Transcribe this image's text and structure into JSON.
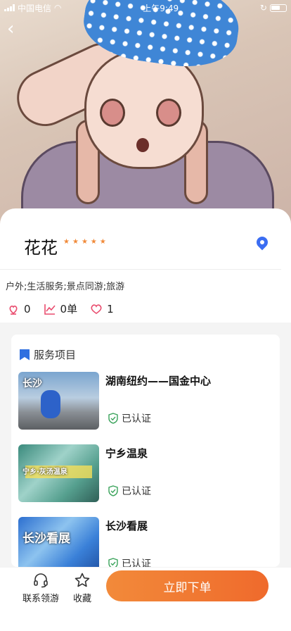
{
  "status_bar": {
    "carrier": "中国电信",
    "time": "上午9:49"
  },
  "provider": {
    "name": "花花",
    "rating_stars": 5,
    "tags": "户外;生活服务;景点同游;旅游",
    "stats": {
      "favorites": "0",
      "orders": "0单",
      "likes": "1"
    }
  },
  "services": {
    "title": "服务项目",
    "items": [
      {
        "title": "湖南纽约——国金中心",
        "thumb_text": "长沙",
        "badge": "已认证"
      },
      {
        "title": "宁乡温泉",
        "thumb_text": "宁乡·灰汤温泉",
        "badge": "已认证"
      },
      {
        "title": "长沙看展",
        "thumb_text": "长沙看展",
        "badge": "已认证"
      }
    ]
  },
  "bottom_bar": {
    "contact_label": "联系领游",
    "favorite_label": "收藏",
    "order_label": "立即下单"
  },
  "colors": {
    "accent": "#ef6a2c",
    "blue": "#2f6fe0",
    "star": "#f08a3a"
  }
}
